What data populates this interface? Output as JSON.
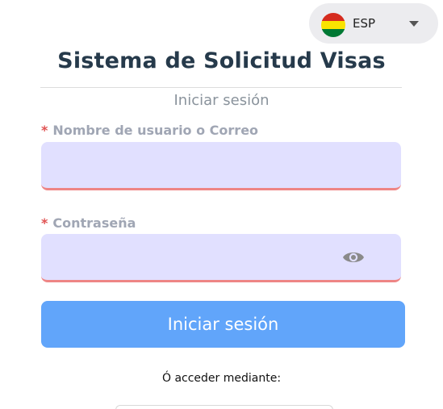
{
  "language": {
    "code": "ESP",
    "flag_colors": [
      "#d52b1e",
      "#f9e300",
      "#007934"
    ]
  },
  "header": {
    "title": "Sistema de Solicitud Visas",
    "subtitle": "Iniciar sesión"
  },
  "form": {
    "username": {
      "required_mark": "*",
      "label": "Nombre de usuario o Correo",
      "value": ""
    },
    "password": {
      "required_mark": "*",
      "label": "Contraseña",
      "value": ""
    },
    "submit_label": "Iniciar sesión"
  },
  "alternate": {
    "label": "Ó acceder mediante:"
  },
  "colors": {
    "title": "#263a4b",
    "input_bg": "#e1e0ff",
    "input_underline": "#ee8585",
    "button": "#61a5fa",
    "required": "#e05252"
  }
}
